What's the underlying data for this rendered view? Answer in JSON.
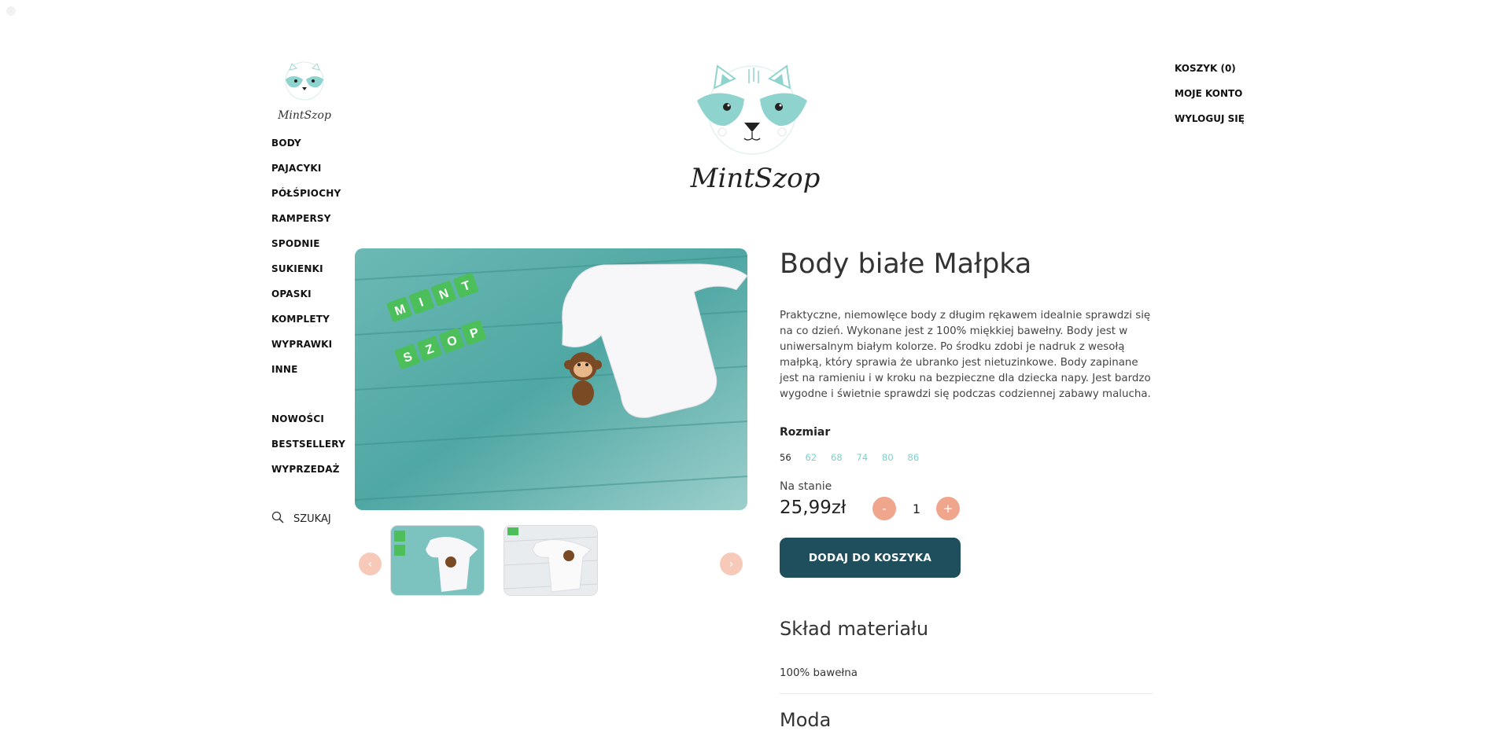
{
  "brand": {
    "name": "MintSzop",
    "colors": {
      "mint": "#8fd3cf",
      "salmon": "#f0a58d",
      "dark_teal": "#1f4f5c"
    }
  },
  "sidebar": {
    "categories": [
      "BODY",
      "PAJACYKI",
      "PÓŁŚPIOCHY",
      "RAMPERSY",
      "SPODNIE",
      "SUKIENKI",
      "OPASKI",
      "KOMPLETY",
      "WYPRAWKI",
      "INNE"
    ],
    "specials": [
      "NOWOŚCI",
      "BESTSELLERY",
      "WYPRZEDAŻ"
    ],
    "search_label": "SZUKAJ",
    "search_icon": "search-icon"
  },
  "header_right": [
    "KOSZYK (0)",
    "MOJE KONTO",
    "WYLOGUJ SIĘ"
  ],
  "gallery": {
    "prev_label": "‹",
    "next_label": "›",
    "blocks_top": [
      "M",
      "I",
      "N",
      "T"
    ],
    "blocks_bottom": [
      "S",
      "Z",
      "O",
      "P"
    ]
  },
  "product": {
    "title": "Body białe Małpka",
    "description": "Praktyczne, niemowlęce body z długim rękawem idealnie sprawdzi się na co dzień. Wykonane jest z 100% miękkiej bawełny. Body jest w uniwersalnym białym kolorze. Po środku zdobi je nadruk z wesołą małpką, który sprawia że ubranko jest nietuzinkowe. Body zapinane jest na ramieniu i w kroku na bezpieczne dla dziecka napy. Jest bardzo wygodne i świetnie sprawdzi się podczas codziennej zabawy malucha.",
    "size_label": "Rozmiar",
    "sizes": [
      "56",
      "62",
      "68",
      "74",
      "80",
      "86"
    ],
    "selected_size": "56",
    "stock_label": "Na stanie",
    "price": "25,99zł",
    "qty_minus": "-",
    "qty": "1",
    "qty_plus": "+",
    "add_to_cart": "DODAJ DO KOSZYKA",
    "material_title": "Skład materiału",
    "material_value": "100% bawełna",
    "next_section_title": "Moda"
  }
}
